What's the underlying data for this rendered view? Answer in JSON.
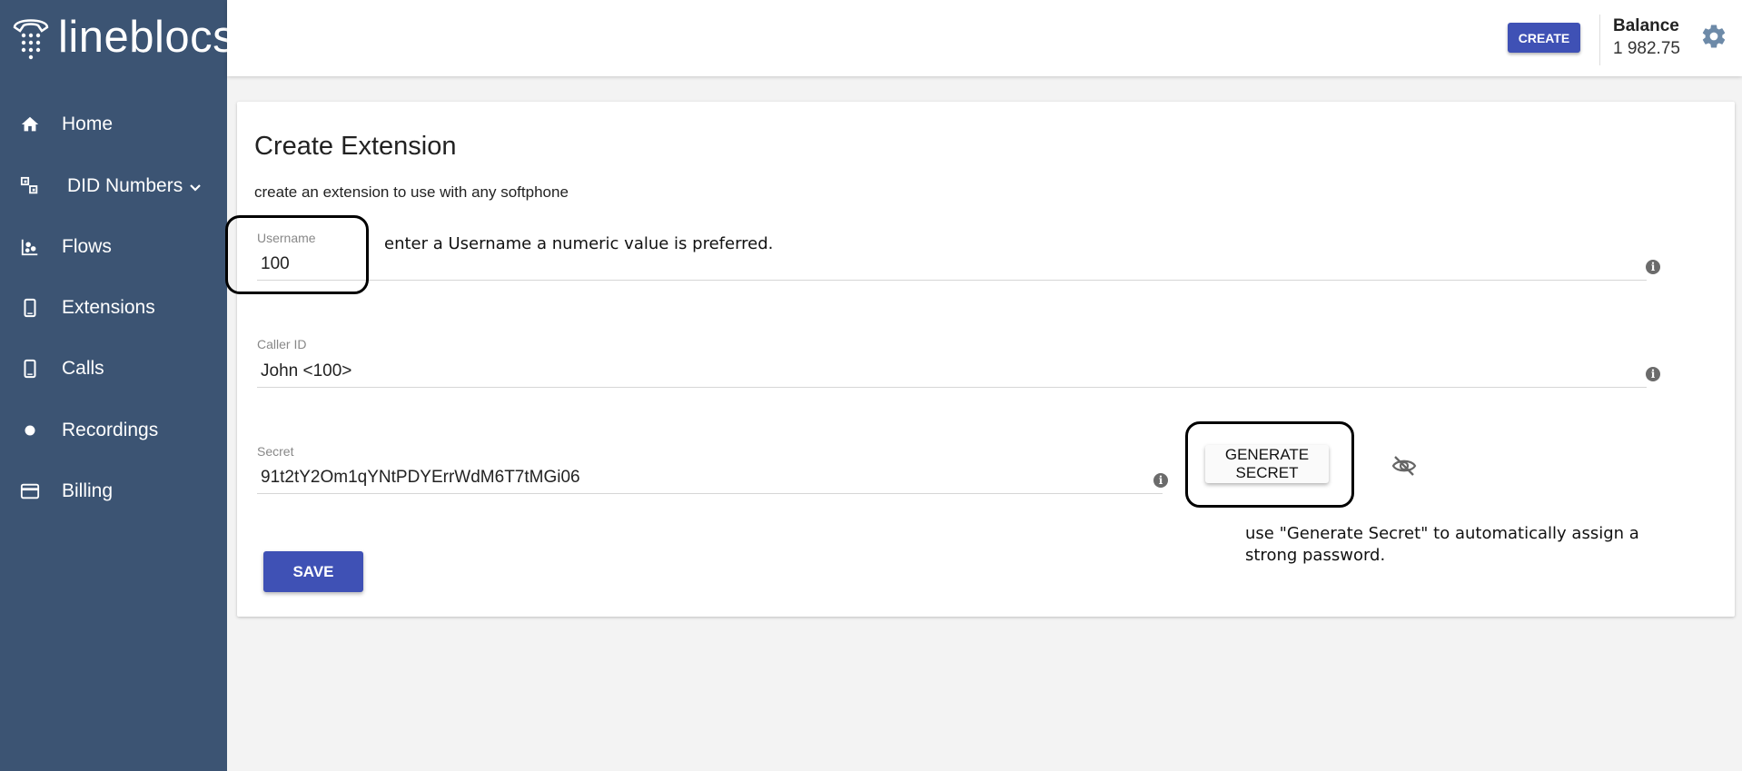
{
  "app": {
    "logo_text": "lineblocs"
  },
  "sidebar": {
    "items": [
      {
        "label": "Home",
        "icon": "home-icon"
      },
      {
        "label": "DID Numbers",
        "icon": "phone-numbers-icon"
      },
      {
        "label": "Flows",
        "icon": "flows-icon"
      },
      {
        "label": "Extensions",
        "icon": "smartphone-icon"
      },
      {
        "label": "Calls",
        "icon": "smartphone-icon"
      },
      {
        "label": "Recordings",
        "icon": "record-dot-icon"
      },
      {
        "label": "Billing",
        "icon": "credit-card-icon"
      }
    ]
  },
  "header": {
    "create_label": "CREATE",
    "balance_label": "Balance",
    "balance_value": "1 982.75"
  },
  "form": {
    "title": "Create Extension",
    "subtitle": "create an extension to use with any softphone",
    "username": {
      "label": "Username",
      "value": "100"
    },
    "caller_id": {
      "label": "Caller ID",
      "value": "John <100>"
    },
    "secret": {
      "label": "Secret",
      "value": "91t2tY2Om1qYNtPDYErrWdM6T7tMGi06"
    },
    "generate_label": "GENERATE SECRET",
    "save_label": "SAVE"
  },
  "annotations": {
    "username_hint": "enter a Username a numeric value is preferred.",
    "secret_hint_line1": "use \"Generate Secret\" to automatically assign a",
    "secret_hint_line2": "strong password."
  },
  "colors": {
    "sidebar": "#3c5473",
    "primary": "#3f51b5"
  }
}
